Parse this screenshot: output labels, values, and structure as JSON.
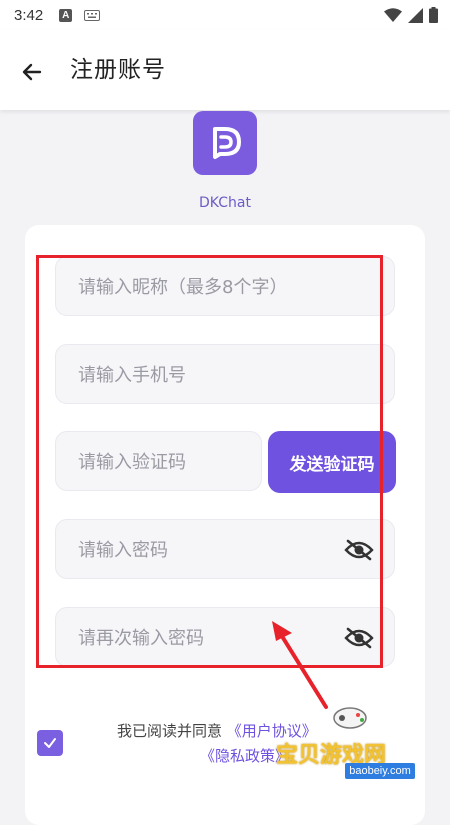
{
  "status_bar": {
    "time": "3:42",
    "notification_letter": "A",
    "icons": [
      "keyboard-icon",
      "wifi-icon",
      "signal-icon",
      "battery-icon"
    ]
  },
  "app_bar": {
    "back_icon": "arrow-left-icon",
    "title": "注册账号"
  },
  "app": {
    "name": "DKChat",
    "brand_color": "#7c5cde"
  },
  "form": {
    "nickname": {
      "value": "",
      "placeholder": "请输入昵称（最多8个字）"
    },
    "phone": {
      "value": "",
      "placeholder": "请输入手机号"
    },
    "code": {
      "value": "",
      "placeholder": "请输入验证码"
    },
    "send_code_label": "发送验证码",
    "password": {
      "value": "",
      "placeholder": "请输入密码",
      "toggle_icon": "eye-off-icon"
    },
    "confirm_password": {
      "value": "",
      "placeholder": "请再次输入密码",
      "toggle_icon": "eye-off-icon"
    }
  },
  "agreement": {
    "checked": true,
    "prefix": "我已阅读并同意",
    "user_agreement": "《用户协议》",
    "privacy_policy": "《隐私政策》"
  },
  "annotation": {
    "highlight_color": "#e8222b"
  },
  "watermark": {
    "text": "宝贝游戏网",
    "url": "baobeiy.com"
  }
}
